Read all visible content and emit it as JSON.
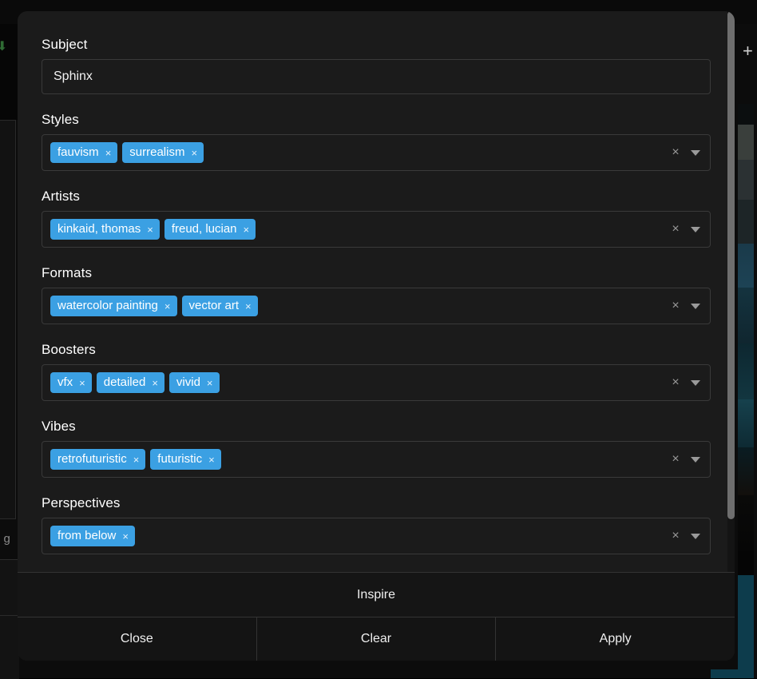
{
  "background": {
    "download_icon": "download-icon",
    "plus_icon": "+",
    "caption_fragment": "n g"
  },
  "modal": {
    "fields": [
      {
        "label": "Subject",
        "type": "text",
        "value": "Sphinx",
        "placeholder": ""
      },
      {
        "label": "Styles",
        "type": "chips",
        "chips": [
          "fauvism",
          "surrealism"
        ],
        "clear_icon": "×",
        "dropdown_icon": "chevron-down-icon"
      },
      {
        "label": "Artists",
        "type": "chips",
        "chips": [
          "kinkaid, thomas",
          "freud, lucian"
        ],
        "clear_icon": "×",
        "dropdown_icon": "chevron-down-icon"
      },
      {
        "label": "Formats",
        "type": "chips",
        "chips": [
          "watercolor painting",
          "vector art"
        ],
        "clear_icon": "×",
        "dropdown_icon": "chevron-down-icon"
      },
      {
        "label": "Boosters",
        "type": "chips",
        "chips": [
          "vfx",
          "detailed",
          "vivid"
        ],
        "clear_icon": "×",
        "dropdown_icon": "chevron-down-icon"
      },
      {
        "label": "Vibes",
        "type": "chips",
        "chips": [
          "retrofuturistic",
          "futuristic"
        ],
        "clear_icon": "×",
        "dropdown_icon": "chevron-down-icon"
      },
      {
        "label": "Perspectives",
        "type": "chips",
        "chips": [
          "from below"
        ],
        "clear_icon": "×",
        "dropdown_icon": "chevron-down-icon"
      }
    ],
    "chip_remove_icon": "×",
    "footer": {
      "inspire_label": "Inspire",
      "close_label": "Close",
      "clear_label": "Clear",
      "apply_label": "Apply"
    }
  },
  "colors": {
    "chip_blue": "#3ba0e3",
    "modal_bg": "#1b1b1b",
    "footer_bg": "#141414",
    "border": "#3a3a3a",
    "text": "#ffffff"
  }
}
